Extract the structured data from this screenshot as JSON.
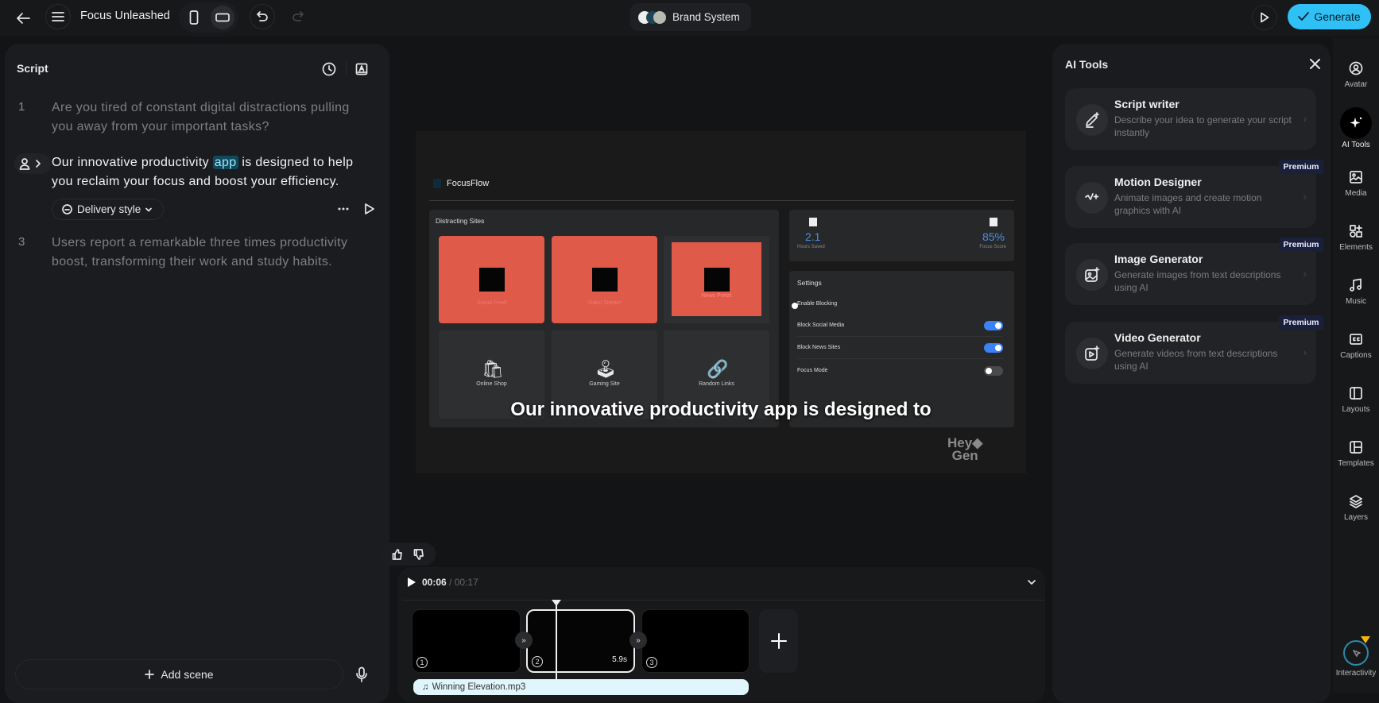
{
  "header": {
    "title": "Focus Unleashed",
    "brand_system": "Brand System",
    "generate": "Generate"
  },
  "script": {
    "title": "Script",
    "lines": [
      {
        "num": "1",
        "text": "Are you tired of constant digital distractions pulling you away from your important tasks?"
      },
      {
        "before": "Our innovative productivity ",
        "highlight": "app",
        "after": " is designed to help you reclaim your focus and boost your efficiency."
      },
      {
        "num": "3",
        "text": "Users report a remarkable three times productivity boost, transforming their work and study habits."
      }
    ],
    "delivery_style": "Delivery style",
    "add_scene": "Add scene"
  },
  "preview": {
    "app_name": "FocusFlow",
    "distracting_title": "Distracting Sites",
    "tiles": [
      "Social Feed",
      "Video Stream",
      "News Portal",
      "Online Shop",
      "Gaming Site",
      "Random Links"
    ],
    "stats": [
      {
        "value": "2.1",
        "label": "Hours Saved"
      },
      {
        "value": "85%",
        "label": "Focus Score"
      }
    ],
    "settings_title": "Settings",
    "settings": [
      {
        "label": "Enable Blocking"
      },
      {
        "label": "Block Social Media",
        "on": true
      },
      {
        "label": "Block News Sites",
        "on": true
      },
      {
        "label": "Focus Mode",
        "on": false
      }
    ],
    "caption": "Our innovative productivity app is designed to",
    "watermark": "HeyGen",
    "watermark_l1": "Hey",
    "watermark_l2": "Gen"
  },
  "timeline": {
    "current": "00:06",
    "sep": "/",
    "total": "00:17",
    "clips": [
      "1",
      "2",
      "3"
    ],
    "clip_duration": "5.9s",
    "audio": "Winning Elevation.mp3"
  },
  "ai_tools": {
    "title": "AI Tools",
    "premium": "Premium",
    "items": [
      {
        "title": "Script writer",
        "desc": "Describe your idea to generate your script instantly"
      },
      {
        "title": "Motion Designer",
        "desc": "Animate images and create motion graphics with AI"
      },
      {
        "title": "Image Generator",
        "desc": "Generate images from text descriptions using AI"
      },
      {
        "title": "Video Generator",
        "desc": "Generate videos from text descriptions using AI"
      }
    ]
  },
  "sidebar": [
    "Avatar",
    "AI Tools",
    "Media",
    "Elements",
    "Music",
    "Captions",
    "Layouts",
    "Templates",
    "Layers",
    "Interactivity"
  ],
  "colors": {
    "accent": "#2fc0f5",
    "red_tile": "#e05a4a",
    "toggle_on": "#3b82f6",
    "highlight": "#0f4a5c"
  }
}
